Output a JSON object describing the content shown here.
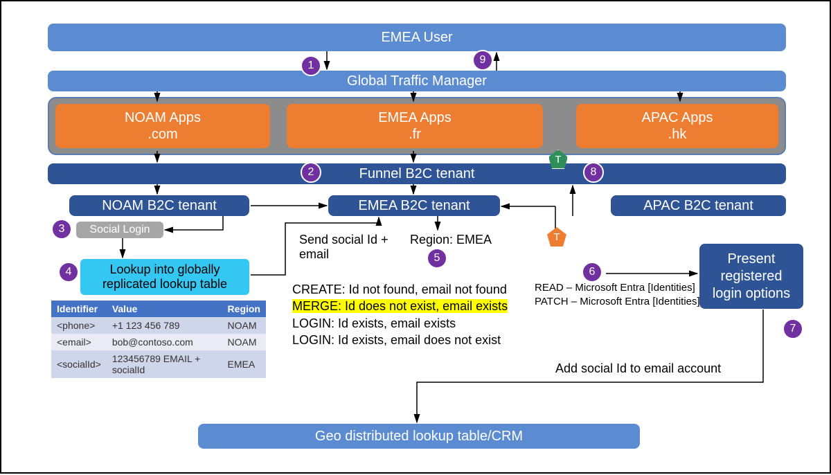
{
  "boxes": {
    "emea_user": "EMEA User",
    "gtm": "Global Traffic Manager",
    "noam_apps_l1": "NOAM Apps",
    "noam_apps_l2": ".com",
    "emea_apps_l1": "EMEA Apps",
    "emea_apps_l2": ".fr",
    "apac_apps_l1": "APAC Apps",
    "apac_apps_l2": ".hk",
    "funnel": "Funnel B2C tenant",
    "noam_tenant": "NOAM B2C tenant",
    "emea_tenant": "EMEA B2C tenant",
    "apac_tenant": "APAC B2C tenant",
    "social": "Social Login",
    "lookup_l1": "Lookup into globally",
    "lookup_l2": "replicated lookup table",
    "present_l1": "Present",
    "present_l2": "registered",
    "present_l3": "login options",
    "geo": "Geo distributed lookup table/CRM"
  },
  "labels": {
    "sendsocial_l1": "Send social Id +",
    "sendsocial_l2": "email",
    "region": "Region: EMEA",
    "create": "CREATE: Id not found, email not found",
    "merge": "MERGE: Id does not exist, email exists",
    "login1": "LOGIN: Id exists, email exists",
    "login2": "LOGIN: Id exists, email does not exist",
    "read": "READ – Microsoft Entra [Identities]",
    "patch": "PATCH – Microsoft Entra [Identities]",
    "addsocial": "Add social Id to email account"
  },
  "steps": {
    "1": "1",
    "2": "2",
    "3": "3",
    "4": "4",
    "5": "5",
    "6": "6",
    "7": "7",
    "8": "8",
    "9": "9"
  },
  "t_badge": "T",
  "table": {
    "headers": [
      "Identifier",
      "Value",
      "Region"
    ],
    "rows": [
      [
        "<phone>",
        "+1 123 456 789",
        "NOAM"
      ],
      [
        "<email>",
        "bob@contoso.com",
        "NOAM"
      ],
      [
        "<socialId>",
        "123456789 EMAIL + socialId",
        "EMEA"
      ]
    ]
  }
}
